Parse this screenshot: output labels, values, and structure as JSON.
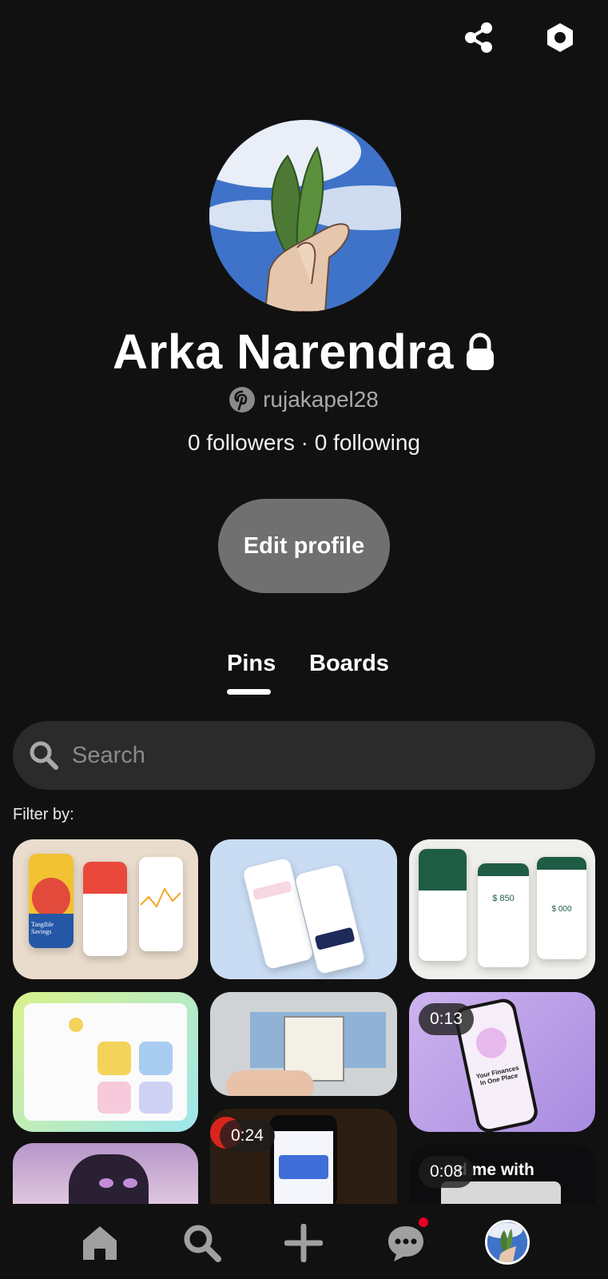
{
  "profile": {
    "name": "Arka Narendra",
    "username": "rujakapel28",
    "followers_text": "0 followers · 0 following"
  },
  "actions": {
    "edit_profile": "Edit profile"
  },
  "tabs": [
    {
      "label": "Pins",
      "active": true
    },
    {
      "label": "Boards",
      "active": false
    }
  ],
  "search": {
    "placeholder": "Search"
  },
  "filter_label": "Filter by:",
  "pins": [
    {
      "badge": ""
    },
    {
      "badge": ""
    },
    {
      "badge": ""
    },
    {
      "badge": ""
    },
    {
      "badge": ""
    },
    {
      "badge": "0:13"
    },
    {
      "badge": ""
    },
    {
      "badge": "0:24"
    },
    {
      "badge": "0:08"
    }
  ],
  "pin_text": {
    "tangible": "Tangible Savings",
    "amount1": "$ 850",
    "amount2": "$ 000",
    "finance": "Your Finances In One Place",
    "love": "d me with"
  },
  "icons": {
    "share": "share-icon",
    "settings": "settings-icon",
    "lock": "lock-icon",
    "pinterest": "pinterest-icon",
    "search": "search-icon",
    "home": "home-icon",
    "explore": "search-nav-icon",
    "create": "plus-icon",
    "messages": "chat-icon",
    "profile": "avatar"
  },
  "colors": {
    "background": "#111111",
    "button": "#707070",
    "notification_dot": "#e60023"
  }
}
